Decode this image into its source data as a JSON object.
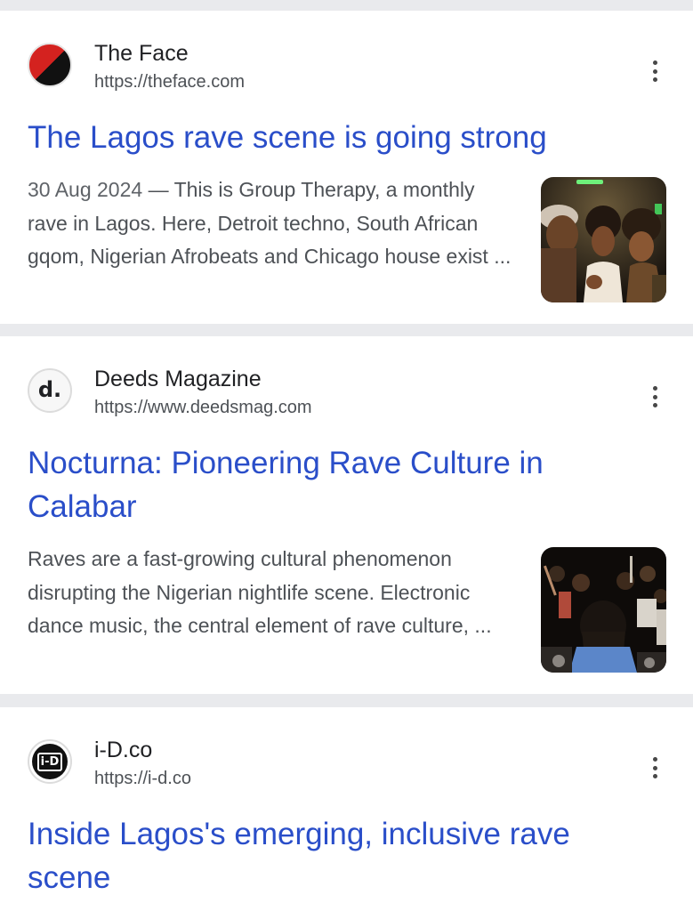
{
  "results": [
    {
      "source": "The Face",
      "url": "https://theface.com",
      "favicon": "the-face-logo",
      "title": "The Lagos rave scene is going strong",
      "date": "30 Aug 2024",
      "separator": " — ",
      "snippet": "This is Group Therapy, a monthly rave in Lagos. Here, Detroit techno, South African gqom, Nigerian Afrobeats and Chicago house exist ...",
      "thumbnail": "rave-crowd-photo"
    },
    {
      "source": "Deeds Magazine",
      "url": "https://www.deedsmag.com",
      "favicon": "deeds-logo",
      "favicon_text": "d.",
      "title": "Nocturna: Pioneering Rave Culture in Calabar",
      "snippet": "Raves are a fast-growing cultural phenomenon disrupting the Nigerian nightlife scene. Electronic dance music, the central element of rave culture, ...",
      "thumbnail": "dj-crowd-photo"
    },
    {
      "source": "i-D.co",
      "url": "https://i-d.co",
      "favicon": "i-d-logo",
      "favicon_text": "i-D",
      "title": "Inside Lagos's emerging, inclusive rave scene"
    }
  ],
  "colors": {
    "link": "#2a4ec9",
    "page_background": "#e9eaed",
    "card_background": "#ffffff"
  }
}
